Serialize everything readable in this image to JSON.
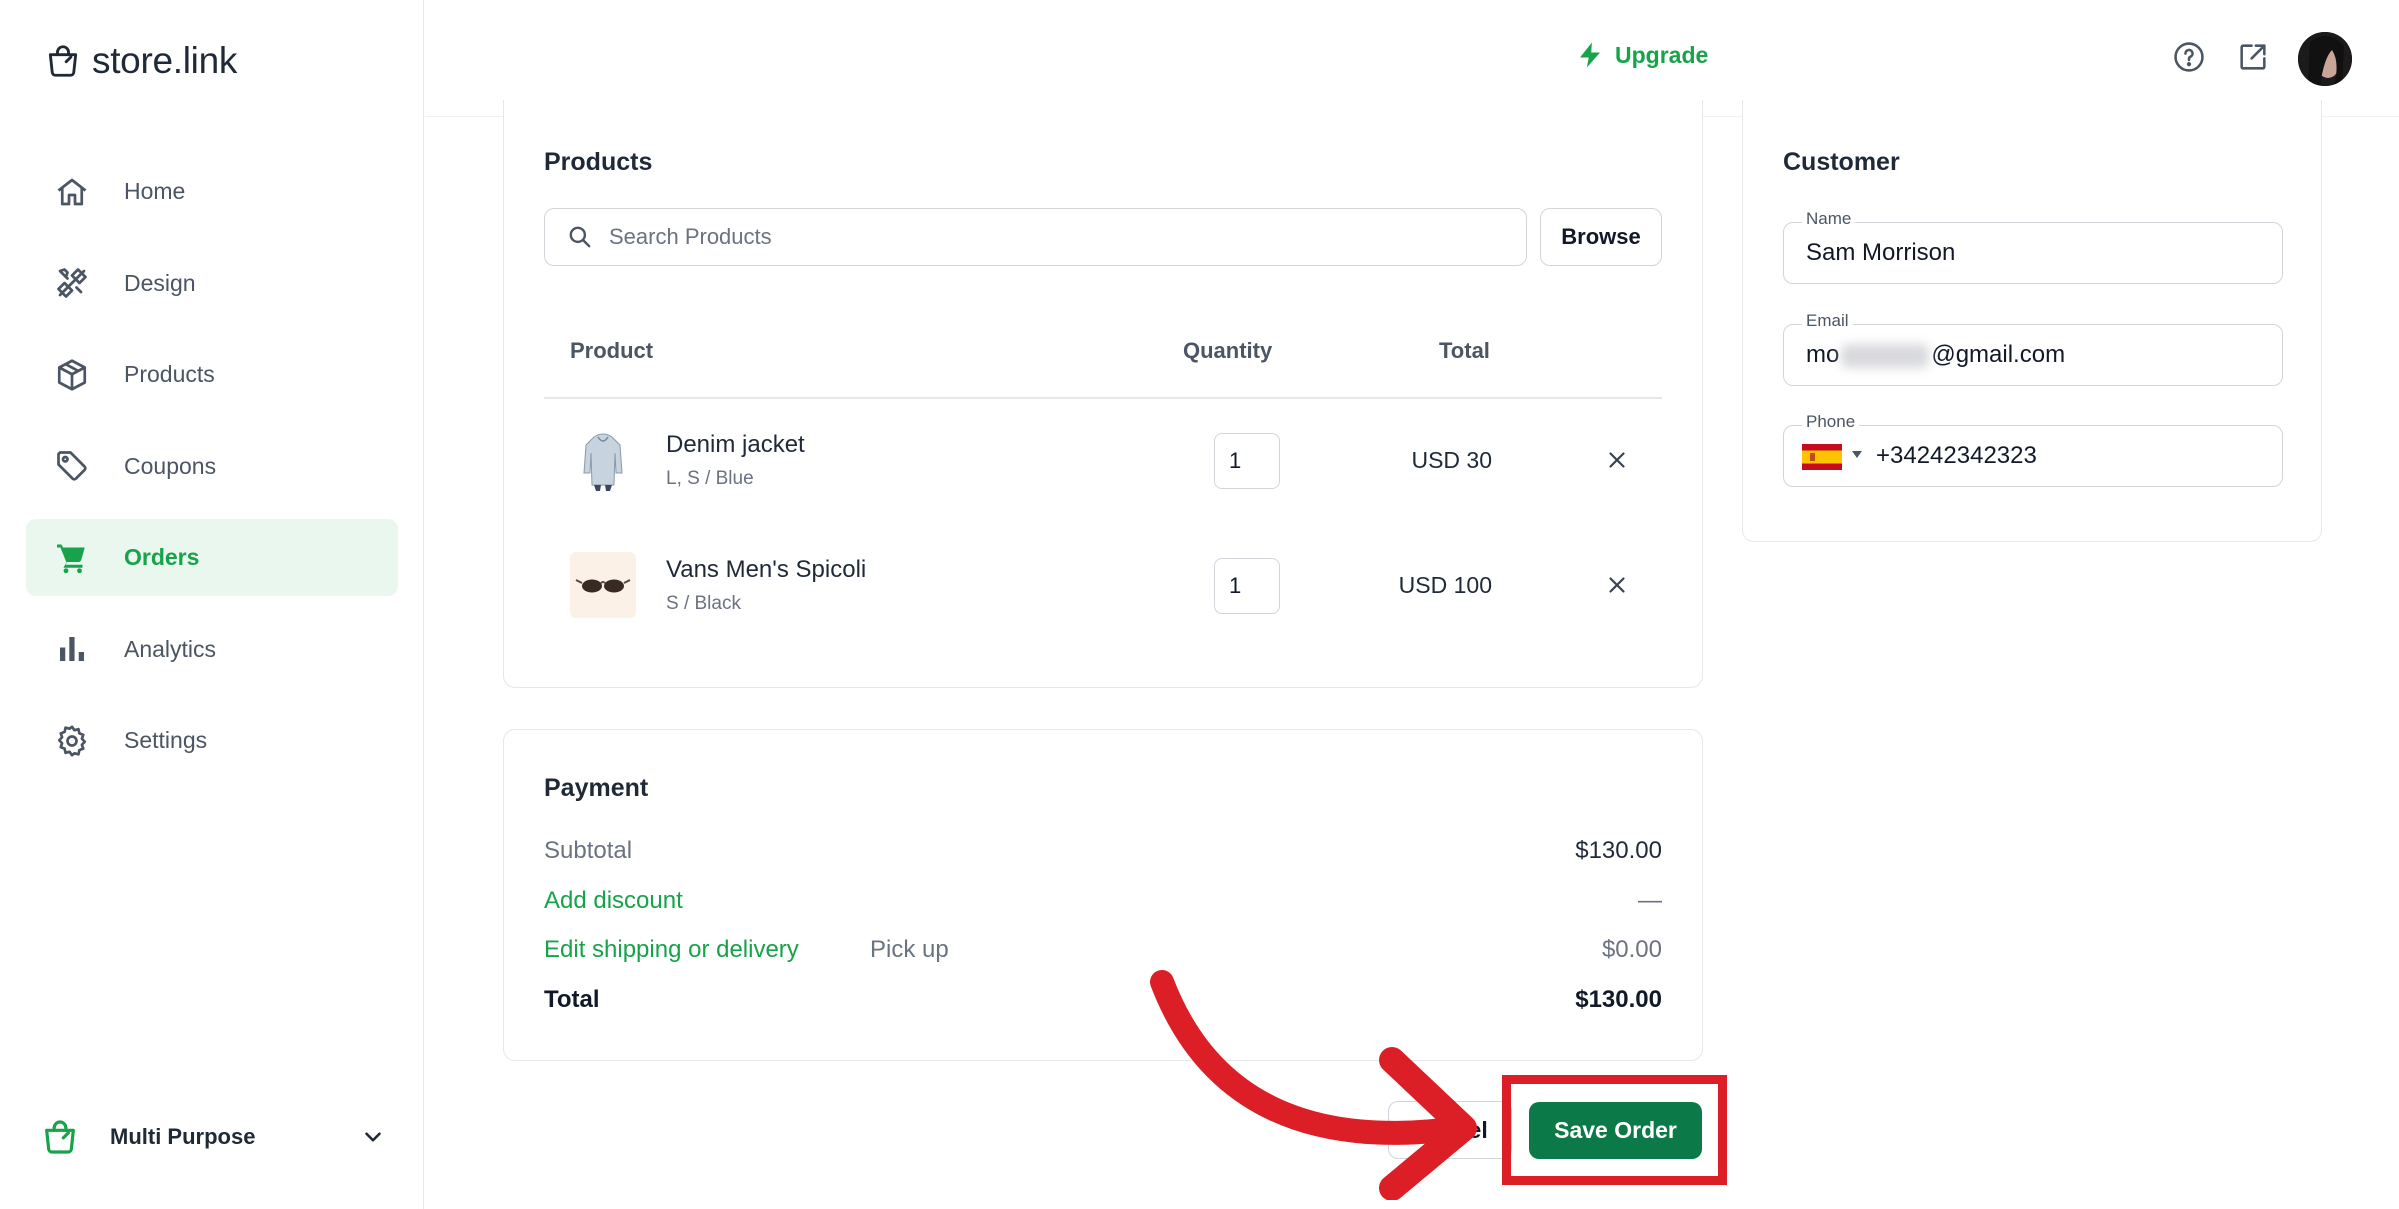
{
  "brand": {
    "name": "store.link"
  },
  "sidebar": {
    "items": [
      {
        "label": "Home",
        "icon": "home-icon"
      },
      {
        "label": "Design",
        "icon": "design-icon"
      },
      {
        "label": "Products",
        "icon": "box-icon"
      },
      {
        "label": "Coupons",
        "icon": "tag-icon"
      },
      {
        "label": "Orders",
        "icon": "cart-icon",
        "active": true
      },
      {
        "label": "Analytics",
        "icon": "bar-chart-icon"
      },
      {
        "label": "Settings",
        "icon": "gear-icon"
      }
    ],
    "store": {
      "name": "Multi Purpose"
    }
  },
  "topbar": {
    "upgrade_label": "Upgrade"
  },
  "products": {
    "title": "Products",
    "search_placeholder": "Search Products",
    "browse_label": "Browse",
    "columns": {
      "product": "Product",
      "quantity": "Quantity",
      "total": "Total"
    },
    "rows": [
      {
        "name": "Denim jacket",
        "variant": "L, S / Blue",
        "quantity": "1",
        "total": "USD 30"
      },
      {
        "name": "Vans Men's Spicoli",
        "variant": "S / Black",
        "quantity": "1",
        "total": "USD 100"
      }
    ]
  },
  "customer": {
    "title": "Customer",
    "name_label": "Name",
    "name_value": "Sam Morrison",
    "email_label": "Email",
    "email_prefix": "mo",
    "email_suffix": "@gmail.com",
    "phone_label": "Phone",
    "phone_value": "+34242342323"
  },
  "payment": {
    "title": "Payment",
    "subtotal_label": "Subtotal",
    "subtotal_value": "$130.00",
    "discount_label": "Add discount",
    "discount_value": "—",
    "shipping_label": "Edit shipping or delivery",
    "shipping_method": "Pick up",
    "shipping_value": "$0.00",
    "total_label": "Total",
    "total_value": "$130.00"
  },
  "actions": {
    "cancel_label": "Cancel",
    "save_label": "Save Order"
  },
  "colors": {
    "accent": "#16a34a",
    "save_button": "#0b7a48",
    "annotation": "#dc1f26"
  }
}
